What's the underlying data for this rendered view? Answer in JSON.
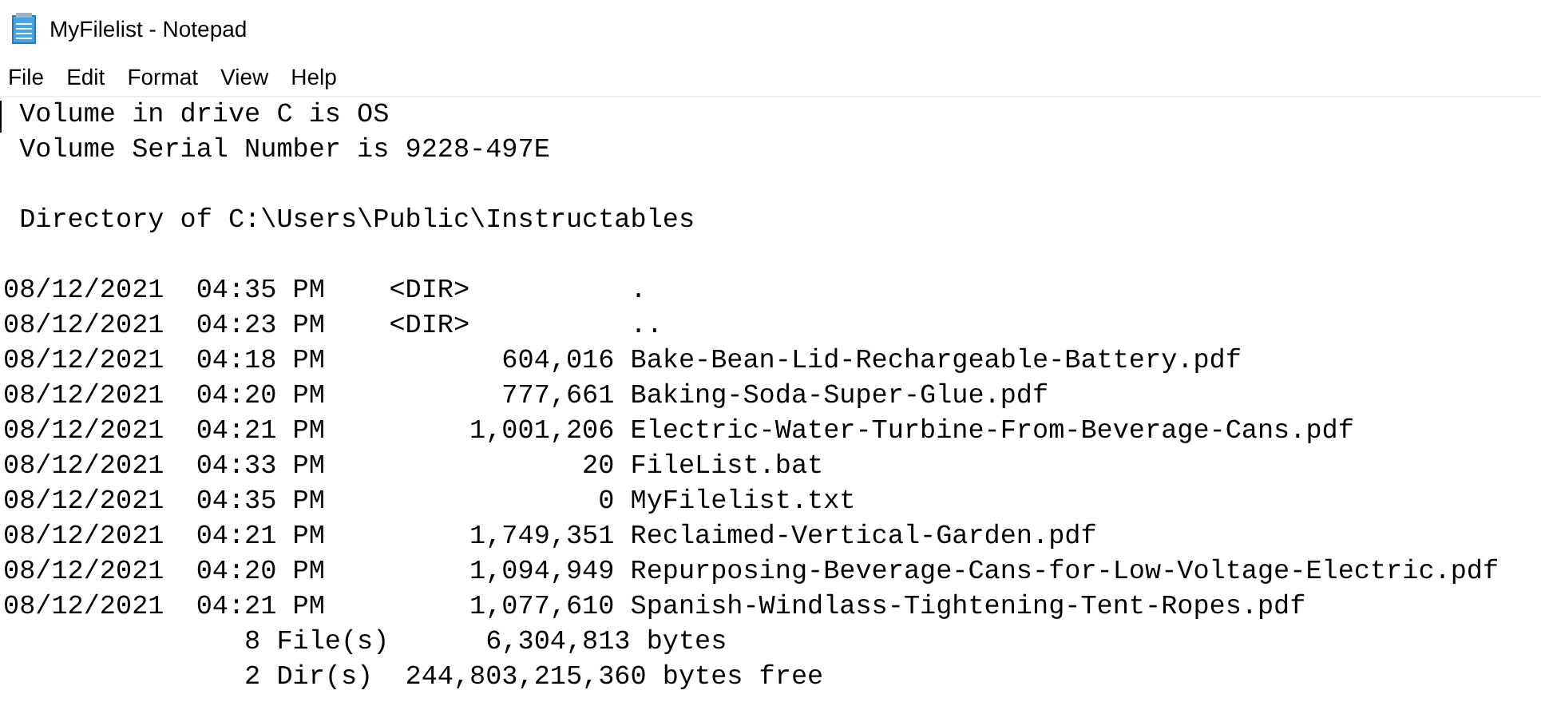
{
  "window": {
    "title": "MyFilelist - Notepad"
  },
  "menu": [
    "File",
    "Edit",
    "Format",
    "View",
    "Help"
  ],
  "editor": {
    "lines": [
      {
        "kind": "text",
        "text": " Volume in drive C is OS"
      },
      {
        "kind": "text",
        "text": " Volume Serial Number is 9228-497E"
      },
      {
        "kind": "blank"
      },
      {
        "kind": "text",
        "text": " Directory of C:\\Users\\Public\\Instructables"
      },
      {
        "kind": "blank"
      },
      {
        "kind": "text",
        "text": "08/12/2021  04:35 PM    <DIR>          ."
      },
      {
        "kind": "text",
        "text": "08/12/2021  04:23 PM    <DIR>          .."
      },
      {
        "kind": "text",
        "text": "08/12/2021  04:18 PM           604,016 Bake-Bean-Lid-Rechargeable-Battery.pdf"
      },
      {
        "kind": "text",
        "text": "08/12/2021  04:20 PM           777,661 Baking-Soda-Super-Glue.pdf"
      },
      {
        "kind": "text",
        "text": "08/12/2021  04:21 PM         1,001,206 Electric-Water-Turbine-From-Beverage-Cans.pdf"
      },
      {
        "kind": "text",
        "text": "08/12/2021  04:33 PM                20 FileList.bat"
      },
      {
        "kind": "text",
        "text": "08/12/2021  04:35 PM                 0 MyFilelist.txt"
      },
      {
        "kind": "text",
        "text": "08/12/2021  04:21 PM         1,749,351 Reclaimed-Vertical-Garden.pdf"
      },
      {
        "kind": "text",
        "text": "08/12/2021  04:20 PM         1,094,949 Repurposing-Beverage-Cans-for-Low-Voltage-Electric.pdf"
      },
      {
        "kind": "text",
        "text": "08/12/2021  04:21 PM         1,077,610 Spanish-Windlass-Tightening-Tent-Ropes.pdf"
      },
      {
        "kind": "text",
        "text": "               8 File(s)      6,304,813 bytes"
      },
      {
        "kind": "text",
        "text": "               2 Dir(s)  244,803,215,360 bytes free"
      }
    ]
  }
}
